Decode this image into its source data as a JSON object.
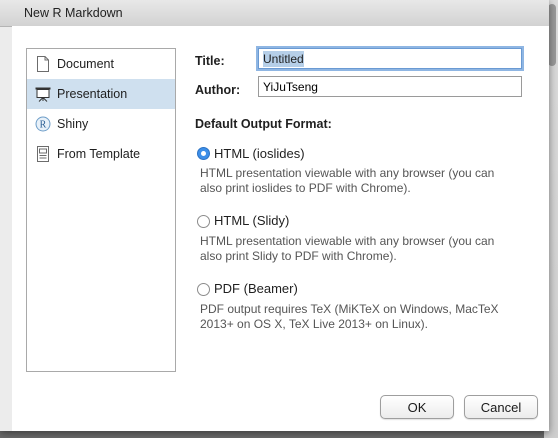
{
  "window": {
    "title": "New R Markdown"
  },
  "sidebar": {
    "items": [
      {
        "label": "Document",
        "icon": "document-icon",
        "active": false
      },
      {
        "label": "Presentation",
        "icon": "presentation-icon",
        "active": true
      },
      {
        "label": "Shiny",
        "icon": "shiny-r-icon",
        "active": false
      },
      {
        "label": "From Template",
        "icon": "template-icon",
        "active": false
      }
    ]
  },
  "form": {
    "title_label": "Title:",
    "title_value": "Untitled",
    "author_label": "Author:",
    "author_value": "YiJuTseng"
  },
  "output": {
    "section_title": "Default Output Format:",
    "options": [
      {
        "label": "HTML (ioslides)",
        "checked": true,
        "desc_line1": "HTML presentation viewable with any browser (you can",
        "desc_line2": "also print ioslides to PDF with Chrome)."
      },
      {
        "label": "HTML (Slidy)",
        "checked": false,
        "desc_line1": "HTML presentation viewable with any browser (you can",
        "desc_line2": "also print Slidy to PDF with Chrome)."
      },
      {
        "label": "PDF (Beamer)",
        "checked": false,
        "desc_line1": "PDF output requires TeX (MiKTeX on Windows, MacTeX",
        "desc_line2": "2013+ on OS X, TeX Live 2013+ on Linux)."
      }
    ]
  },
  "buttons": {
    "ok": "OK",
    "cancel": "Cancel"
  },
  "colors": {
    "selection_bg": "#cfe0ef",
    "radio_checked": "#3c8ee8",
    "focus_ring": "#8fb6e3"
  }
}
